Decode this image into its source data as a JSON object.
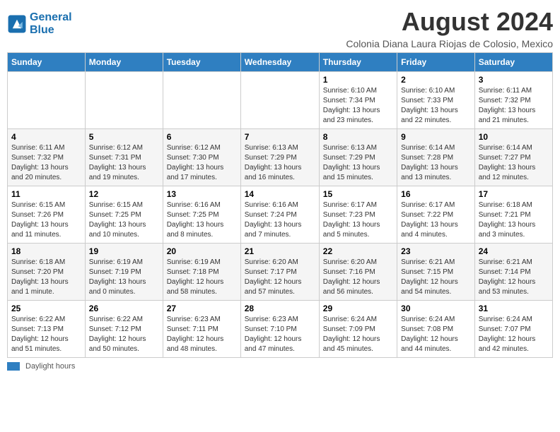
{
  "logo": {
    "line1": "General",
    "line2": "Blue"
  },
  "title": "August 2024",
  "location": "Colonia Diana Laura Riojas de Colosio, Mexico",
  "days_of_week": [
    "Sunday",
    "Monday",
    "Tuesday",
    "Wednesday",
    "Thursday",
    "Friday",
    "Saturday"
  ],
  "weeks": [
    [
      {
        "day": "",
        "info": ""
      },
      {
        "day": "",
        "info": ""
      },
      {
        "day": "",
        "info": ""
      },
      {
        "day": "",
        "info": ""
      },
      {
        "day": "1",
        "info": "Sunrise: 6:10 AM\nSunset: 7:34 PM\nDaylight: 13 hours and 23 minutes."
      },
      {
        "day": "2",
        "info": "Sunrise: 6:10 AM\nSunset: 7:33 PM\nDaylight: 13 hours and 22 minutes."
      },
      {
        "day": "3",
        "info": "Sunrise: 6:11 AM\nSunset: 7:32 PM\nDaylight: 13 hours and 21 minutes."
      }
    ],
    [
      {
        "day": "4",
        "info": "Sunrise: 6:11 AM\nSunset: 7:32 PM\nDaylight: 13 hours and 20 minutes."
      },
      {
        "day": "5",
        "info": "Sunrise: 6:12 AM\nSunset: 7:31 PM\nDaylight: 13 hours and 19 minutes."
      },
      {
        "day": "6",
        "info": "Sunrise: 6:12 AM\nSunset: 7:30 PM\nDaylight: 13 hours and 17 minutes."
      },
      {
        "day": "7",
        "info": "Sunrise: 6:13 AM\nSunset: 7:29 PM\nDaylight: 13 hours and 16 minutes."
      },
      {
        "day": "8",
        "info": "Sunrise: 6:13 AM\nSunset: 7:29 PM\nDaylight: 13 hours and 15 minutes."
      },
      {
        "day": "9",
        "info": "Sunrise: 6:14 AM\nSunset: 7:28 PM\nDaylight: 13 hours and 13 minutes."
      },
      {
        "day": "10",
        "info": "Sunrise: 6:14 AM\nSunset: 7:27 PM\nDaylight: 13 hours and 12 minutes."
      }
    ],
    [
      {
        "day": "11",
        "info": "Sunrise: 6:15 AM\nSunset: 7:26 PM\nDaylight: 13 hours and 11 minutes."
      },
      {
        "day": "12",
        "info": "Sunrise: 6:15 AM\nSunset: 7:25 PM\nDaylight: 13 hours and 10 minutes."
      },
      {
        "day": "13",
        "info": "Sunrise: 6:16 AM\nSunset: 7:25 PM\nDaylight: 13 hours and 8 minutes."
      },
      {
        "day": "14",
        "info": "Sunrise: 6:16 AM\nSunset: 7:24 PM\nDaylight: 13 hours and 7 minutes."
      },
      {
        "day": "15",
        "info": "Sunrise: 6:17 AM\nSunset: 7:23 PM\nDaylight: 13 hours and 5 minutes."
      },
      {
        "day": "16",
        "info": "Sunrise: 6:17 AM\nSunset: 7:22 PM\nDaylight: 13 hours and 4 minutes."
      },
      {
        "day": "17",
        "info": "Sunrise: 6:18 AM\nSunset: 7:21 PM\nDaylight: 13 hours and 3 minutes."
      }
    ],
    [
      {
        "day": "18",
        "info": "Sunrise: 6:18 AM\nSunset: 7:20 PM\nDaylight: 13 hours and 1 minute."
      },
      {
        "day": "19",
        "info": "Sunrise: 6:19 AM\nSunset: 7:19 PM\nDaylight: 13 hours and 0 minutes."
      },
      {
        "day": "20",
        "info": "Sunrise: 6:19 AM\nSunset: 7:18 PM\nDaylight: 12 hours and 58 minutes."
      },
      {
        "day": "21",
        "info": "Sunrise: 6:20 AM\nSunset: 7:17 PM\nDaylight: 12 hours and 57 minutes."
      },
      {
        "day": "22",
        "info": "Sunrise: 6:20 AM\nSunset: 7:16 PM\nDaylight: 12 hours and 56 minutes."
      },
      {
        "day": "23",
        "info": "Sunrise: 6:21 AM\nSunset: 7:15 PM\nDaylight: 12 hours and 54 minutes."
      },
      {
        "day": "24",
        "info": "Sunrise: 6:21 AM\nSunset: 7:14 PM\nDaylight: 12 hours and 53 minutes."
      }
    ],
    [
      {
        "day": "25",
        "info": "Sunrise: 6:22 AM\nSunset: 7:13 PM\nDaylight: 12 hours and 51 minutes."
      },
      {
        "day": "26",
        "info": "Sunrise: 6:22 AM\nSunset: 7:12 PM\nDaylight: 12 hours and 50 minutes."
      },
      {
        "day": "27",
        "info": "Sunrise: 6:23 AM\nSunset: 7:11 PM\nDaylight: 12 hours and 48 minutes."
      },
      {
        "day": "28",
        "info": "Sunrise: 6:23 AM\nSunset: 7:10 PM\nDaylight: 12 hours and 47 minutes."
      },
      {
        "day": "29",
        "info": "Sunrise: 6:24 AM\nSunset: 7:09 PM\nDaylight: 12 hours and 45 minutes."
      },
      {
        "day": "30",
        "info": "Sunrise: 6:24 AM\nSunset: 7:08 PM\nDaylight: 12 hours and 44 minutes."
      },
      {
        "day": "31",
        "info": "Sunrise: 6:24 AM\nSunset: 7:07 PM\nDaylight: 12 hours and 42 minutes."
      }
    ]
  ],
  "footer": {
    "swatch_label": "Daylight hours"
  }
}
